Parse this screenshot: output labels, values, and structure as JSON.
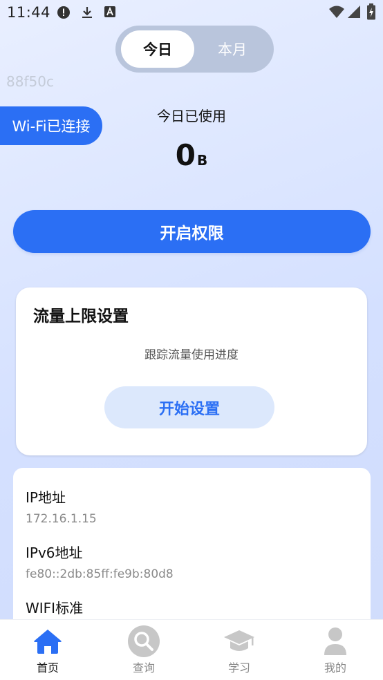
{
  "status_bar": {
    "time": "11:44",
    "icons": [
      "alert-icon",
      "download-icon",
      "a-icon",
      "wifi-icon",
      "signal-icon",
      "battery-icon"
    ]
  },
  "segmented": {
    "tabs": [
      {
        "label": "今日",
        "selected": true
      },
      {
        "label": "本月",
        "selected": false
      }
    ]
  },
  "debug_code": "88f50c",
  "wifi_badge": "Wi-Fi已连接",
  "usage": {
    "title": "今日已使用",
    "value": "0",
    "unit": "B"
  },
  "permission_button": "开启权限",
  "limit_card": {
    "title": "流量上限设置",
    "description": "跟踪流量使用进度",
    "button": "开始设置"
  },
  "network_info": [
    {
      "label": "IP地址",
      "value": "172.16.1.15"
    },
    {
      "label": "IPv6地址",
      "value": "fe80::2db:85ff:fe9b:80d8"
    },
    {
      "label": "WIFI标准",
      "value": ""
    }
  ],
  "tab_bar": {
    "tabs": [
      {
        "label": "首页",
        "icon": "home-icon",
        "active": true
      },
      {
        "label": "查询",
        "icon": "search-icon",
        "active": false
      },
      {
        "label": "学习",
        "icon": "graduation-cap-icon",
        "active": false
      },
      {
        "label": "我的",
        "icon": "user-icon",
        "active": false
      }
    ]
  },
  "colors": {
    "accent": "#2b6ff4",
    "accent_light": "#dce8fc",
    "tab_inactive": "#c7c7c7"
  }
}
